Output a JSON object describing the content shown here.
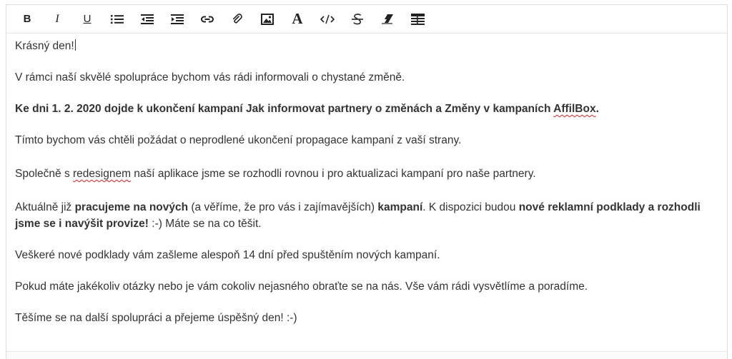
{
  "toolbar": {
    "bold_label": "B",
    "italic_label": "I",
    "underline_label": "U",
    "font_label": "A",
    "icons": [
      "bold-icon",
      "italic-icon",
      "underline-icon",
      "bullet-list-icon",
      "outdent-icon",
      "indent-icon",
      "link-icon",
      "attachment-icon",
      "image-icon",
      "font-icon",
      "code-icon",
      "strikethrough-icon",
      "eraser-icon",
      "table-icon"
    ]
  },
  "content": {
    "p1": "Krásný den!",
    "p2": "V rámci naší skvělé spolupráce bychom vás rádi informovali o chystané změně.",
    "p3_bold_a": "Ke dni 1. 2. 2020 dojde k ukončení kampaní Jak informovat partnery o změnách a Změny v kampaních ",
    "p3_bold_spell": "AffilBox",
    "p3_bold_end": ".",
    "p4": "Tímto bychom vás chtěli požádat o neprodlené ukončení propagace kampaní z vaší strany.",
    "p5_a": "Společně s ",
    "p5_spell": "redesignem",
    "p5_b": " naší aplikace jsme se rozhodli rovnou i pro aktualizaci kampaní pro naše partnery.",
    "p6_a": "Aktuálně již ",
    "p6_b1": "pracujeme na nových",
    "p6_c": " (a věříme, že pro vás i zajímavějších) ",
    "p6_b2": "kampaní",
    "p6_d": ". K dispozici budou ",
    "p6_b3": "nové reklamní podklady a rozhodli jsme se i navýšit provize!",
    "p6_e": " :-) Máte se na co těšit.",
    "p7": "Veškeré nové podklady vám zašleme alespoň 14 dní před spuštěním nových kampaní.",
    "p8": "Pokud máte jakékoliv otázky nebo je vám cokoliv nejasného obraťte se na nás. Vše vám rádi vysvětlíme a poradíme.",
    "p9": "Těšíme se na další spolupráci a přejeme úspěšný den! :-)"
  }
}
